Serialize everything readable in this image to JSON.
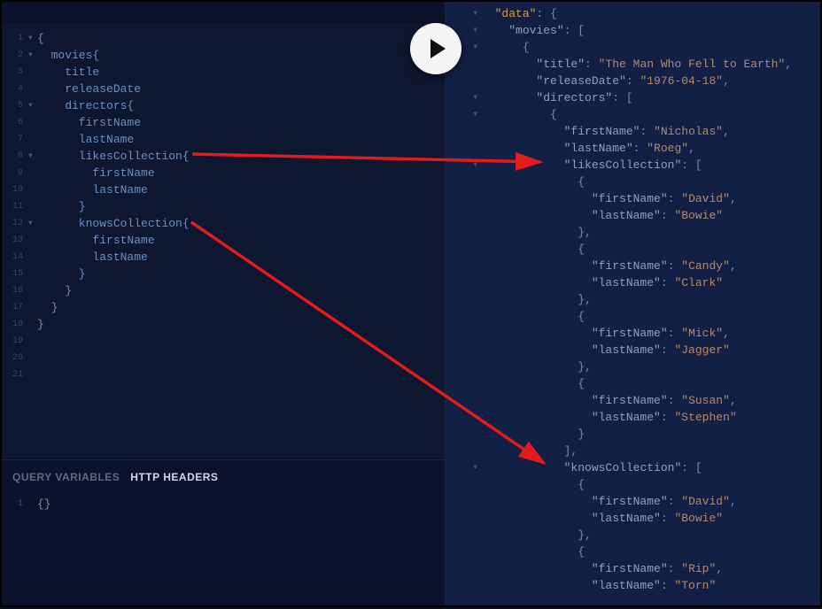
{
  "tabs": {
    "queryVariables": "QUERY VARIABLES",
    "httpHeaders": "HTTP HEADERS"
  },
  "queryVarsValue": "{}",
  "query": {
    "lines": [
      {
        "n": 1,
        "fold": true,
        "indent": 0,
        "text": "{"
      },
      {
        "n": 2,
        "fold": true,
        "indent": 1,
        "text": "movies{"
      },
      {
        "n": 3,
        "fold": false,
        "indent": 2,
        "text": "title"
      },
      {
        "n": 4,
        "fold": false,
        "indent": 2,
        "text": "releaseDate"
      },
      {
        "n": 5,
        "fold": true,
        "indent": 2,
        "text": "directors{"
      },
      {
        "n": 6,
        "fold": false,
        "indent": 3,
        "text": "firstName"
      },
      {
        "n": 7,
        "fold": false,
        "indent": 3,
        "text": "lastName"
      },
      {
        "n": 8,
        "fold": true,
        "indent": 3,
        "text": "likesCollection{"
      },
      {
        "n": 9,
        "fold": false,
        "indent": 4,
        "text": "firstName"
      },
      {
        "n": 10,
        "fold": false,
        "indent": 4,
        "text": "lastName"
      },
      {
        "n": 11,
        "fold": false,
        "indent": 3,
        "text": "}"
      },
      {
        "n": 12,
        "fold": true,
        "indent": 3,
        "text": "knowsCollection{"
      },
      {
        "n": 13,
        "fold": false,
        "indent": 4,
        "text": "firstName"
      },
      {
        "n": 14,
        "fold": false,
        "indent": 4,
        "text": "lastName"
      },
      {
        "n": 15,
        "fold": false,
        "indent": 3,
        "text": "}"
      },
      {
        "n": 16,
        "fold": false,
        "indent": 2,
        "text": "}"
      },
      {
        "n": 17,
        "fold": false,
        "indent": 1,
        "text": "}"
      },
      {
        "n": 18,
        "fold": false,
        "indent": 0,
        "text": "}"
      },
      {
        "n": 19,
        "fold": false,
        "indent": 0,
        "text": ""
      },
      {
        "n": 20,
        "fold": false,
        "indent": 0,
        "text": ""
      },
      {
        "n": 21,
        "fold": false,
        "indent": 0,
        "text": ""
      }
    ]
  },
  "result": {
    "lines": [
      {
        "fold": true,
        "indent": 1,
        "tokens": [
          {
            "t": "hl",
            "v": "\"data\""
          },
          {
            "t": "pn",
            "v": ": {"
          }
        ]
      },
      {
        "fold": true,
        "indent": 2,
        "tokens": [
          {
            "t": "key",
            "v": "\"movies\""
          },
          {
            "t": "pn",
            "v": ": ["
          }
        ]
      },
      {
        "fold": true,
        "indent": 3,
        "tokens": [
          {
            "t": "pn",
            "v": "{"
          }
        ]
      },
      {
        "fold": false,
        "indent": 4,
        "tokens": [
          {
            "t": "key",
            "v": "\"title\""
          },
          {
            "t": "pn",
            "v": ": "
          },
          {
            "t": "str",
            "v": "\"The Man Who Fell to Earth\""
          },
          {
            "t": "pn",
            "v": ","
          }
        ]
      },
      {
        "fold": false,
        "indent": 4,
        "tokens": [
          {
            "t": "key",
            "v": "\"releaseDate\""
          },
          {
            "t": "pn",
            "v": ": "
          },
          {
            "t": "str",
            "v": "\"1976-04-18\""
          },
          {
            "t": "pn",
            "v": ","
          }
        ]
      },
      {
        "fold": true,
        "indent": 4,
        "tokens": [
          {
            "t": "key",
            "v": "\"directors\""
          },
          {
            "t": "pn",
            "v": ": ["
          }
        ]
      },
      {
        "fold": true,
        "indent": 5,
        "tokens": [
          {
            "t": "pn",
            "v": "{"
          }
        ]
      },
      {
        "fold": false,
        "indent": 6,
        "tokens": [
          {
            "t": "key",
            "v": "\"firstName\""
          },
          {
            "t": "pn",
            "v": ": "
          },
          {
            "t": "str",
            "v": "\"Nicholas\""
          },
          {
            "t": "pn",
            "v": ","
          }
        ]
      },
      {
        "fold": false,
        "indent": 6,
        "tokens": [
          {
            "t": "key",
            "v": "\"lastName\""
          },
          {
            "t": "pn",
            "v": ": "
          },
          {
            "t": "str",
            "v": "\"Roeg\""
          },
          {
            "t": "pn",
            "v": ","
          }
        ]
      },
      {
        "fold": true,
        "indent": 6,
        "tokens": [
          {
            "t": "key",
            "v": "\"likesCollection\""
          },
          {
            "t": "pn",
            "v": ": ["
          }
        ]
      },
      {
        "fold": false,
        "indent": 7,
        "tokens": [
          {
            "t": "pn",
            "v": "{"
          }
        ]
      },
      {
        "fold": false,
        "indent": 8,
        "tokens": [
          {
            "t": "key",
            "v": "\"firstName\""
          },
          {
            "t": "pn",
            "v": ": "
          },
          {
            "t": "str",
            "v": "\"David\""
          },
          {
            "t": "pn",
            "v": ","
          }
        ]
      },
      {
        "fold": false,
        "indent": 8,
        "tokens": [
          {
            "t": "key",
            "v": "\"lastName\""
          },
          {
            "t": "pn",
            "v": ": "
          },
          {
            "t": "str",
            "v": "\"Bowie\""
          }
        ]
      },
      {
        "fold": false,
        "indent": 7,
        "tokens": [
          {
            "t": "pn",
            "v": "},"
          }
        ]
      },
      {
        "fold": false,
        "indent": 7,
        "tokens": [
          {
            "t": "pn",
            "v": "{"
          }
        ]
      },
      {
        "fold": false,
        "indent": 8,
        "tokens": [
          {
            "t": "key",
            "v": "\"firstName\""
          },
          {
            "t": "pn",
            "v": ": "
          },
          {
            "t": "str",
            "v": "\"Candy\""
          },
          {
            "t": "pn",
            "v": ","
          }
        ]
      },
      {
        "fold": false,
        "indent": 8,
        "tokens": [
          {
            "t": "key",
            "v": "\"lastName\""
          },
          {
            "t": "pn",
            "v": ": "
          },
          {
            "t": "str",
            "v": "\"Clark\""
          }
        ]
      },
      {
        "fold": false,
        "indent": 7,
        "tokens": [
          {
            "t": "pn",
            "v": "},"
          }
        ]
      },
      {
        "fold": false,
        "indent": 7,
        "tokens": [
          {
            "t": "pn",
            "v": "{"
          }
        ]
      },
      {
        "fold": false,
        "indent": 8,
        "tokens": [
          {
            "t": "key",
            "v": "\"firstName\""
          },
          {
            "t": "pn",
            "v": ": "
          },
          {
            "t": "str",
            "v": "\"Mick\""
          },
          {
            "t": "pn",
            "v": ","
          }
        ]
      },
      {
        "fold": false,
        "indent": 8,
        "tokens": [
          {
            "t": "key",
            "v": "\"lastName\""
          },
          {
            "t": "pn",
            "v": ": "
          },
          {
            "t": "str",
            "v": "\"Jagger\""
          }
        ]
      },
      {
        "fold": false,
        "indent": 7,
        "tokens": [
          {
            "t": "pn",
            "v": "},"
          }
        ]
      },
      {
        "fold": false,
        "indent": 7,
        "tokens": [
          {
            "t": "pn",
            "v": "{"
          }
        ]
      },
      {
        "fold": false,
        "indent": 8,
        "tokens": [
          {
            "t": "key",
            "v": "\"firstName\""
          },
          {
            "t": "pn",
            "v": ": "
          },
          {
            "t": "str",
            "v": "\"Susan\""
          },
          {
            "t": "pn",
            "v": ","
          }
        ]
      },
      {
        "fold": false,
        "indent": 8,
        "tokens": [
          {
            "t": "key",
            "v": "\"lastName\""
          },
          {
            "t": "pn",
            "v": ": "
          },
          {
            "t": "str",
            "v": "\"Stephen\""
          }
        ]
      },
      {
        "fold": false,
        "indent": 7,
        "tokens": [
          {
            "t": "pn",
            "v": "}"
          }
        ]
      },
      {
        "fold": false,
        "indent": 6,
        "tokens": [
          {
            "t": "pn",
            "v": "],"
          }
        ]
      },
      {
        "fold": true,
        "indent": 6,
        "tokens": [
          {
            "t": "key",
            "v": "\"knowsCollection\""
          },
          {
            "t": "pn",
            "v": ": ["
          }
        ]
      },
      {
        "fold": false,
        "indent": 7,
        "tokens": [
          {
            "t": "pn",
            "v": "{"
          }
        ]
      },
      {
        "fold": false,
        "indent": 8,
        "tokens": [
          {
            "t": "key",
            "v": "\"firstName\""
          },
          {
            "t": "pn",
            "v": ": "
          },
          {
            "t": "str",
            "v": "\"David\""
          },
          {
            "t": "pn",
            "v": ","
          }
        ]
      },
      {
        "fold": false,
        "indent": 8,
        "tokens": [
          {
            "t": "key",
            "v": "\"lastName\""
          },
          {
            "t": "pn",
            "v": ": "
          },
          {
            "t": "str",
            "v": "\"Bowie\""
          }
        ]
      },
      {
        "fold": false,
        "indent": 7,
        "tokens": [
          {
            "t": "pn",
            "v": "},"
          }
        ]
      },
      {
        "fold": false,
        "indent": 7,
        "tokens": [
          {
            "t": "pn",
            "v": "{"
          }
        ]
      },
      {
        "fold": false,
        "indent": 8,
        "tokens": [
          {
            "t": "key",
            "v": "\"firstName\""
          },
          {
            "t": "pn",
            "v": ": "
          },
          {
            "t": "str",
            "v": "\"Rip\""
          },
          {
            "t": "pn",
            "v": ","
          }
        ]
      },
      {
        "fold": false,
        "indent": 8,
        "tokens": [
          {
            "t": "key",
            "v": "\"lastName\""
          },
          {
            "t": "pn",
            "v": ": "
          },
          {
            "t": "str",
            "v": "\"Torn\""
          }
        ]
      }
    ]
  }
}
